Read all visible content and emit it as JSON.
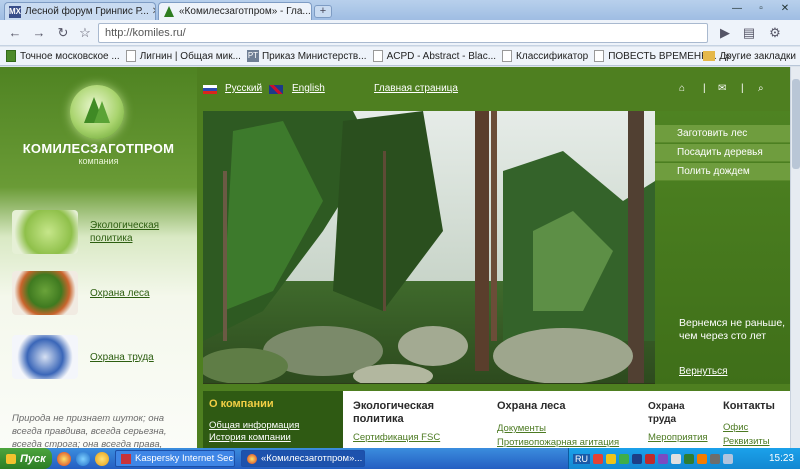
{
  "browser": {
    "tabs": [
      {
        "label": "Лесной форум Гринпис Р...",
        "favicon": "mx-icon",
        "active": false
      },
      {
        "label": "«Комилесзаготпром» - Гла...",
        "favicon": "tree-icon",
        "active": true
      }
    ],
    "address": "http://komiles.ru/",
    "bookmarks": [
      "Точное московское ...",
      "Лигнин | Общая мик...",
      "Приказ Министерств...",
      "ACPD - Abstract - Blac...",
      "Классификатор",
      "ПОВЕСТЬ ВРЕМЕНН..."
    ],
    "bookmarks_overflow": "»",
    "other_bookmarks": "Другие закладки"
  },
  "site": {
    "brand": "КОМИЛЕСЗАГОТПРОМ",
    "brand_sub": "компания",
    "lang_ru": "Русский",
    "lang_en": "English",
    "home_link": "Главная страница",
    "util_sep": "|",
    "left_nav": [
      {
        "label": "Экологическая политика"
      },
      {
        "label": "Охрана леса"
      },
      {
        "label": "Охрана труда"
      }
    ],
    "quote": "Природа не признает шуток; она всегда правдива, всегда серьезна, всегда строга; она всегда права,",
    "right_menu": [
      "Заготовить лес",
      "Посадить деревья",
      "Полить дождем"
    ],
    "right_text": "Вернемся не раньше, чем через сто лет",
    "right_back": "Вернуться",
    "about": {
      "title": "О компании",
      "links": [
        "Общая информация",
        "История компании"
      ]
    },
    "columns": [
      {
        "title": "Экологическая политика",
        "links": [
          "Сертификация FSC"
        ]
      },
      {
        "title": "Охрана леса",
        "links": [
          "Документы",
          "Противопожарная агитация"
        ]
      },
      {
        "title": "Охрана труда",
        "links": [
          "Мероприятия"
        ]
      },
      {
        "title": "Контакты",
        "links": [
          "Офис",
          "Реквизиты"
        ]
      }
    ]
  },
  "taskbar": {
    "start": "Пуск",
    "windows": [
      {
        "label": "Kaspersky Internet Securi...",
        "active": false
      },
      {
        "label": "«Комилесзаготпром»...",
        "active": true
      }
    ],
    "lang": "RU",
    "clock": "15:23"
  },
  "colors": {
    "site_green": "#4e7f20",
    "accent_yellow": "#f2cf45",
    "about_bg": "#2f5a13"
  }
}
